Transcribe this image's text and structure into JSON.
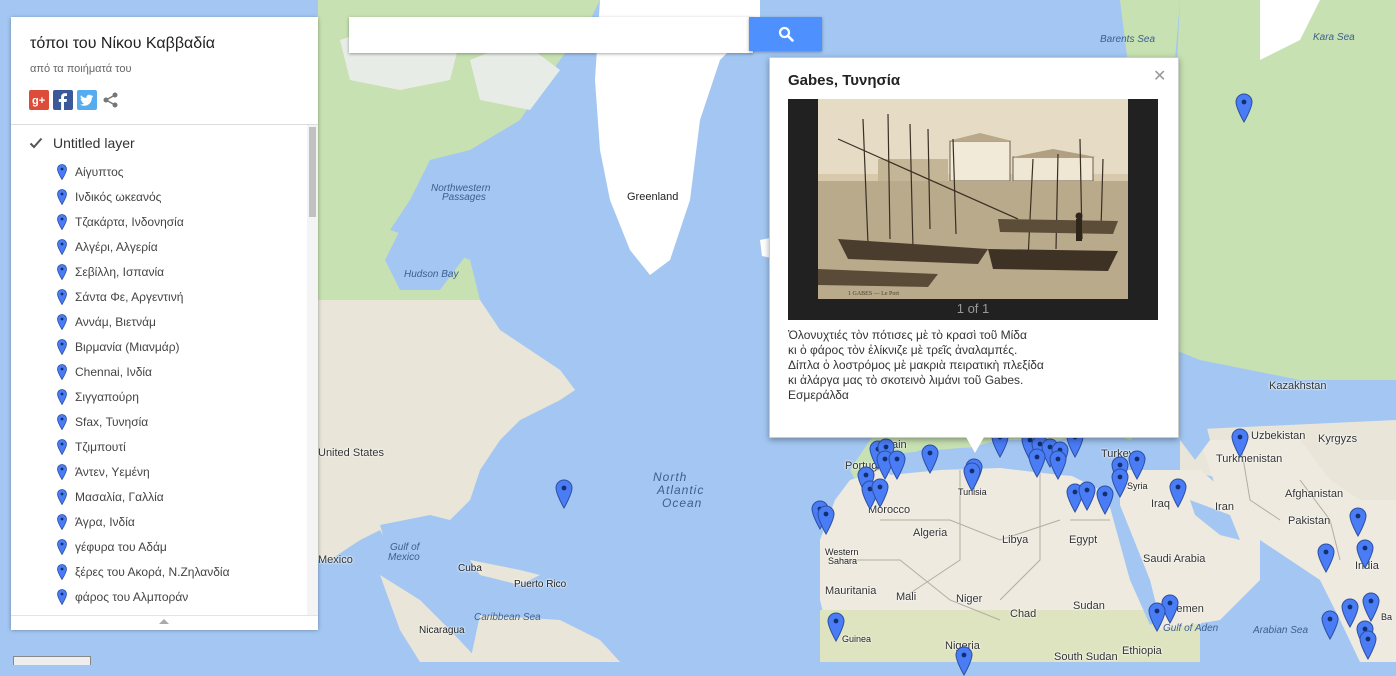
{
  "search": {
    "placeholder": "",
    "value": ""
  },
  "panel": {
    "title": "τόποι του Νίκου Καββαδία",
    "description": "από τα ποιήματά του",
    "layer_name": "Untitled layer",
    "layer_checked": true,
    "places": [
      "Αίγυπτος",
      "Ινδικός ωκεανός",
      "Τζακάρτα, Ινδονησία",
      "Αλγέρι, Αλγερία",
      "Σεβίλλη, Ισπανία",
      "Σάντα Φε, Αργεντινή",
      "Αννάμ, Βιετνάμ",
      "Βιρμανία (Μιανμάρ)",
      "Chennai, Ινδία",
      "Σιγγαπούρη",
      "Sfax, Τυνησία",
      "Τζιμπουτί",
      "Άντεν, Υεμένη",
      "Μασαλία, Γαλλία",
      "Άγρα, Ινδία",
      "γέφυρα του Αδάμ",
      "ξέρες του Ακορά, Ν.Ζηλανδία",
      "φάρος του Αλμποράν"
    ]
  },
  "info_window": {
    "title": "Gabes, Τυνησία",
    "counter": "1 of 1",
    "text_lines": [
      "Ὀλονυχτιές τὸν πότισες μὲ τὸ κρασὶ τοῦ Μίδα",
      "κι ὁ φάρος τὸν ἐλίκνιζε μὲ τρεῖς ἀναλαμπές.",
      "Δίπλα ὁ λοστρόμος μὲ μακριὰ πειρατικὴ πλεξίδα",
      "κι ἀλάργα μας τὸ σκοτεινὸ λιμάνι τοῦ Gabes.",
      "Εσμεράλδα"
    ],
    "photo_caption": "1  GABES — Le Port"
  },
  "map_labels": {
    "barents": "Barents Sea",
    "kara": "Kara Sea",
    "greenland": "Greenland",
    "nw_passages_1": "Northwestern",
    "nw_passages_2": "Passages",
    "hudson": "Hudson Bay",
    "united_states": "United States",
    "gulf_mexico_1": "Gulf of",
    "gulf_mexico_2": "Mexico",
    "mexico": "Mexico",
    "cuba": "Cuba",
    "puerto_rico": "Puerto Rico",
    "caribbean": "Caribbean Sea",
    "nicaragua": "Nicaragua",
    "north_atlantic_1": "North",
    "north_atlantic_2": "Atlantic",
    "north_atlantic_3": "Ocean",
    "portugal": "Portug",
    "spain": "Spain",
    "morocco": "Morocco",
    "western_sahara_1": "Western",
    "western_sahara_2": "Sahara",
    "mauritania": "Mauritania",
    "mali": "Mali",
    "guinea": "Guinea",
    "algeria": "Algeria",
    "tunisia": "Tunisia",
    "libya": "Libya",
    "niger": "Niger",
    "nigeria": "Nigeria",
    "chad": "Chad",
    "egypt": "Egypt",
    "sudan": "Sudan",
    "south_sudan": "South Sudan",
    "ethiopia": "Ethiopia",
    "turkey": "Turkey",
    "syria": "Syria",
    "iraq": "Iraq",
    "iran": "Iran",
    "saudi": "Saudi Arabia",
    "yemen": "Yemen",
    "gulf_aden": "Gulf of Aden",
    "arabian_sea": "Arabian Sea",
    "kazakhstan": "Kazakhstan",
    "uzbekistan": "Uzbekistan",
    "kyrgyz": "Kyrgyzs",
    "turkmenistan": "Turkmenistan",
    "afghanistan": "Afghanistan",
    "pakistan": "Pakistan",
    "india": "India",
    "ba": "Ba",
    "ain": "ain"
  },
  "colors": {
    "ocean": "#a3c7f2",
    "land": "#eeeadf",
    "ice": "#ffffff",
    "green": "#c9e4b7",
    "pin": "#4a7cf5",
    "search_button": "#4d90fe"
  }
}
